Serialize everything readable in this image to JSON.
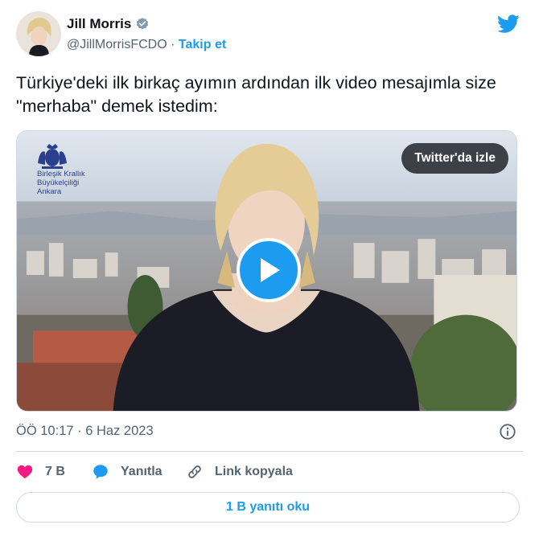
{
  "author": {
    "name": "Jill Morris",
    "handle": "@JillMorrisFCDO",
    "separator": "·",
    "follow_label": "Takip et"
  },
  "tweet": {
    "text": "Türkiye'deki ilk birkaç ayımın ardından ilk video mesajımla size \"merhaba\" demek istedim:"
  },
  "media": {
    "watch_label": "Twitter'da izle",
    "embassy_line1": "Birleşik Krallık",
    "embassy_line2": "Büyükelçiliği",
    "embassy_line3": "Ankara"
  },
  "meta": {
    "time": "ÖÖ 10:17",
    "separator": "·",
    "date": "6 Haz 2023"
  },
  "actions": {
    "like_count": "7 B",
    "reply_label": "Yanıtla",
    "copy_link_label": "Link kopyala"
  },
  "read_replies_label": "1 B yanıtı oku",
  "colors": {
    "accent": "#1d9bf0",
    "like": "#f91880",
    "text": "#0f1419",
    "secondary": "#536471"
  },
  "icons": {
    "verified": "verified-badge-icon",
    "brand": "twitter-bird-icon",
    "play": "play-icon",
    "info": "info-icon",
    "like": "heart-icon",
    "reply": "speech-bubble-icon",
    "link": "link-icon"
  }
}
